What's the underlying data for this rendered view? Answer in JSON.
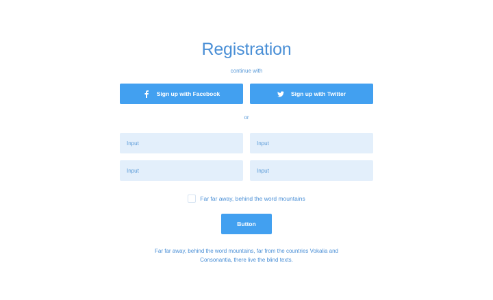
{
  "header": {
    "title": "Registration",
    "subtitle": "continue with"
  },
  "social": {
    "facebook_label": "Sign up with Facebook",
    "facebook_icon": "facebook-icon",
    "twitter_label": "Sign up with Twitter",
    "twitter_icon": "twitter-icon"
  },
  "divider_text": "or",
  "inputs": [
    {
      "placeholder": "Input",
      "value": ""
    },
    {
      "placeholder": "Input",
      "value": ""
    },
    {
      "placeholder": "Input",
      "value": ""
    },
    {
      "placeholder": "Input",
      "value": ""
    }
  ],
  "agreement": {
    "checked": false,
    "label": "Far far away, behind the word mountains"
  },
  "submit_label": "Button",
  "footer_text": "Far far away, behind the word mountains, far from the countries Vokalia and Consonantia, there live the blind texts.",
  "colors": {
    "accent": "#42a0f0",
    "text": "#4a8fd6",
    "input_bg": "#e3effb"
  }
}
